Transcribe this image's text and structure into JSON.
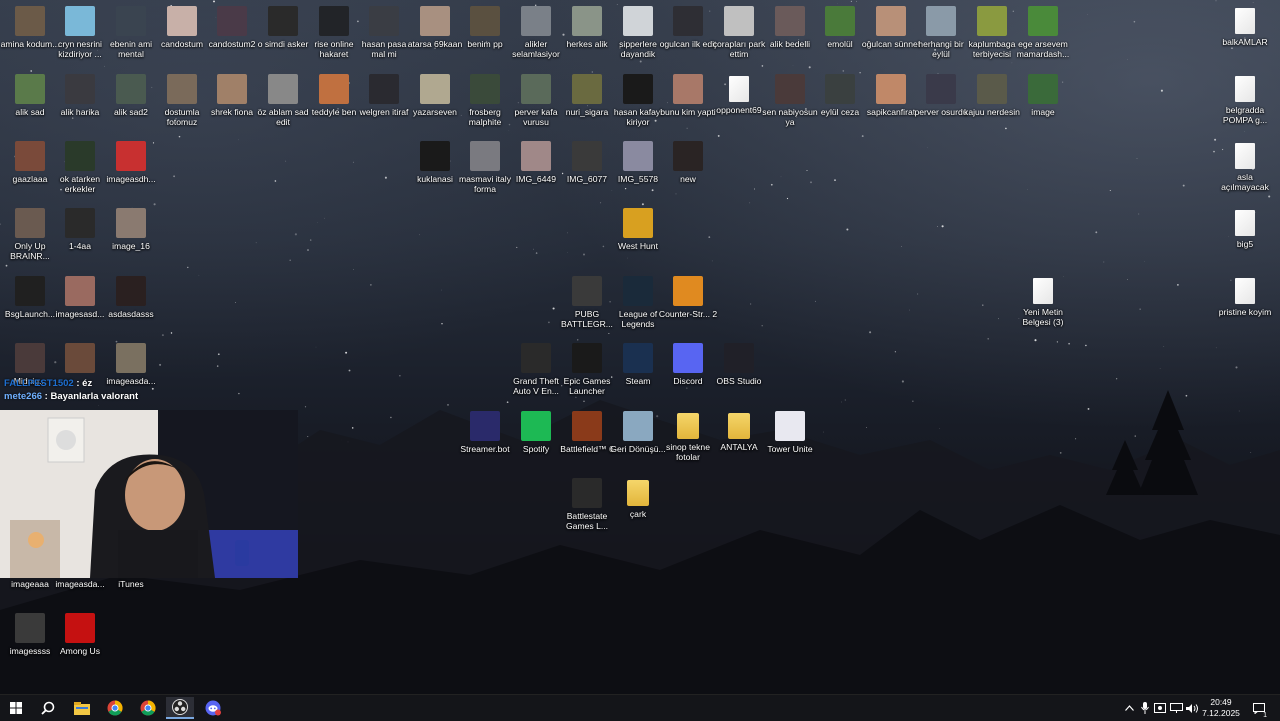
{
  "desktop": {
    "icons": [
      {
        "label": "amina kodum...",
        "color": "#6b5a48"
      },
      {
        "label": "cryn nesrini kizdiriyor ...",
        "color": "#7ab8d8"
      },
      {
        "label": "ebenin ami mental",
        "color": "#3a4450"
      },
      {
        "label": "candostum",
        "color": "#c8b0a8"
      },
      {
        "label": "candostum2",
        "color": "#4a3a48"
      },
      {
        "label": "o simdi asker",
        "color": "#2a2a2a"
      },
      {
        "label": "rise online hakaret",
        "color": "#222428"
      },
      {
        "label": "hasan pasa mal mi",
        "color": "#3a3d44"
      },
      {
        "label": "atarsa 69kaan",
        "color": "#a89080"
      },
      {
        "label": "benim pp",
        "color": "#5a5040"
      },
      {
        "label": "alikler selamlasiyor",
        "color": "#7a8088"
      },
      {
        "label": "herkes alik",
        "color": "#8a9488"
      },
      {
        "label": "sipperlere dayandik",
        "color": "#d0d4d8"
      },
      {
        "label": "ogulcan ilk edit",
        "color": "#2e2e34"
      },
      {
        "label": "çorapları park ettim",
        "color": "#c0c0c0"
      },
      {
        "label": "alik bedelli",
        "color": "#6a5a5a"
      },
      {
        "label": "emolül",
        "color": "#4a7a3a"
      },
      {
        "label": "oğulcan sünnet",
        "color": "#b89078"
      },
      {
        "label": "herhangi bir eylül",
        "color": "#8a9aa8"
      },
      {
        "label": "kaplumbaga terbiyecisi",
        "color": "#8a9a40"
      },
      {
        "label": "ege arsevem mamardash...",
        "color": "#4a8a3a"
      },
      {
        "label": "balkAMLAR",
        "color": "doc"
      },
      {
        "label": "alik sad",
        "color": "#5a7a4a"
      },
      {
        "label": "alik harika",
        "color": "#3a3a40"
      },
      {
        "label": "alik sad2",
        "color": "#4a5a50"
      },
      {
        "label": "dostumla fotomuz",
        "color": "#7a6a5a"
      },
      {
        "label": "shrek fiona",
        "color": "#a08068"
      },
      {
        "label": "öz ablam sad edit",
        "color": "#888"
      },
      {
        "label": "teddyle ben",
        "color": "#c07040"
      },
      {
        "label": "welgren itiraf",
        "color": "#2a2a30"
      },
      {
        "label": "yazarseven",
        "color": "#b0a890"
      },
      {
        "label": "frosberg malphite",
        "color": "#3a4a3a"
      },
      {
        "label": "perver kafa vurusu",
        "color": "#5a6a5a"
      },
      {
        "label": "nuri_sigara",
        "color": "#6a6a40"
      },
      {
        "label": "hasan kafayi kiriyor",
        "color": "#1a1a1a"
      },
      {
        "label": "bunu kim yapti",
        "color": "#a87868"
      },
      {
        "label": "opponent69",
        "color": "doc"
      },
      {
        "label": "sen nabiyosun ya",
        "color": "#4a3a3a"
      },
      {
        "label": "eylül ceza",
        "color": "#3a4040"
      },
      {
        "label": "sapikcanfirat",
        "color": "#c08868"
      },
      {
        "label": "perver osurdu",
        "color": "#3a3a4a"
      },
      {
        "label": "kajuu nerdesin",
        "color": "#5a5a4a"
      },
      {
        "label": "image",
        "color": "#3a6a3a"
      },
      {
        "label": "belgradda POMPA g...",
        "color": "doc"
      },
      {
        "label": "gaazlaaa",
        "color": "#7a4a3a"
      },
      {
        "label": "ok atarken erkekler",
        "color": "#2a3a2a"
      },
      {
        "label": "imageasdh...",
        "color": "#c83030"
      },
      {
        "label": "kuklanasi",
        "color": "#1a1a1a"
      },
      {
        "label": "masmavi italy forma",
        "color": "#7a7a80"
      },
      {
        "label": "IMG_6449",
        "color": "#a08888"
      },
      {
        "label": "IMG_6077",
        "color": "#3a3a3a"
      },
      {
        "label": "IMG_5578",
        "color": "#8a8aa0"
      },
      {
        "label": "new",
        "color": "#2a2424"
      },
      {
        "label": "asla açılmayacak",
        "color": "doc"
      },
      {
        "label": "Only Up BRAINR...",
        "color": "#6a5a50"
      },
      {
        "label": "1-4aa",
        "color": "#2a2a2a"
      },
      {
        "label": "image_16",
        "color": "#8a7a70"
      },
      {
        "label": "West Hunt",
        "color": "#d8a020"
      },
      {
        "label": "big5",
        "color": "doc"
      },
      {
        "label": "BsgLaunch...",
        "color": "#202020"
      },
      {
        "label": "imagesasd...",
        "color": "#9a6a60"
      },
      {
        "label": "asdasdasss",
        "color": "#2a2020"
      },
      {
        "label": "PUBG BATTLEGR...",
        "color": "#3a3a3a"
      },
      {
        "label": "League of Legends",
        "color": "#1a2a3a"
      },
      {
        "label": "Counter-Str... 2",
        "color": "#e08a20"
      },
      {
        "label": "Yeni Metin Belgesi (3)",
        "color": "doc"
      },
      {
        "label": "pristine koyim",
        "color": "doc"
      },
      {
        "label": "Midnig...",
        "color": "#4a3a3a"
      },
      {
        "label": "",
        "color": "#6a4a3a"
      },
      {
        "label": "imageasda...",
        "color": "#7a7060"
      },
      {
        "label": "Grand Theft Auto V En...",
        "color": "#2a2a2a"
      },
      {
        "label": "Epic Games Launcher",
        "color": "#1a1a1a"
      },
      {
        "label": "Steam",
        "color": "#1a3050"
      },
      {
        "label": "Discord",
        "color": "#5865f2"
      },
      {
        "label": "OBS Studio",
        "color": "#202028"
      },
      {
        "label": "Streamer.bot",
        "color": "#2a2a6a"
      },
      {
        "label": "Spotify",
        "color": "#1db954"
      },
      {
        "label": "Battlefield™ 6",
        "color": "#8a3a1a"
      },
      {
        "label": "Geri Dönüşü...",
        "color": "#8aa8c0"
      },
      {
        "label": "sinop tekne fotolar",
        "color": "folder"
      },
      {
        "label": "ANTALYA",
        "color": "folder"
      },
      {
        "label": "Tower Unite",
        "color": "#e8e8f0"
      },
      {
        "label": "Battlestate Games L...",
        "color": "#2a2a2a"
      },
      {
        "label": "çark",
        "color": "folder"
      },
      {
        "label": "imageaaa",
        "color": "#6a5a50"
      },
      {
        "label": "imageasda...",
        "color": "#6a6a60"
      },
      {
        "label": "iTunes",
        "color": "#e0e0e8"
      },
      {
        "label": "imagessss",
        "color": "#3a3a3a"
      },
      {
        "label": "Among Us",
        "color": "#c51111"
      }
    ]
  },
  "chat": [
    {
      "user": "FALLPEST1502",
      "message": "éz",
      "user_color": "#1e6fd0"
    },
    {
      "user": "mete266",
      "message": "Bayanlarla valorant",
      "user_color": "#6fb0ff"
    }
  ],
  "taskbar": {
    "start_icon": "windows-start-icon",
    "search_icon": "search-icon",
    "pinned": [
      "file-explorer-icon",
      "chrome-icon",
      "chrome-icon",
      "obs-icon",
      "discord-ptb-icon"
    ],
    "clock": {
      "time": "20:49",
      "date": "7.12.2025"
    },
    "notification_count": "1",
    "accent": "#7aa8e0"
  }
}
